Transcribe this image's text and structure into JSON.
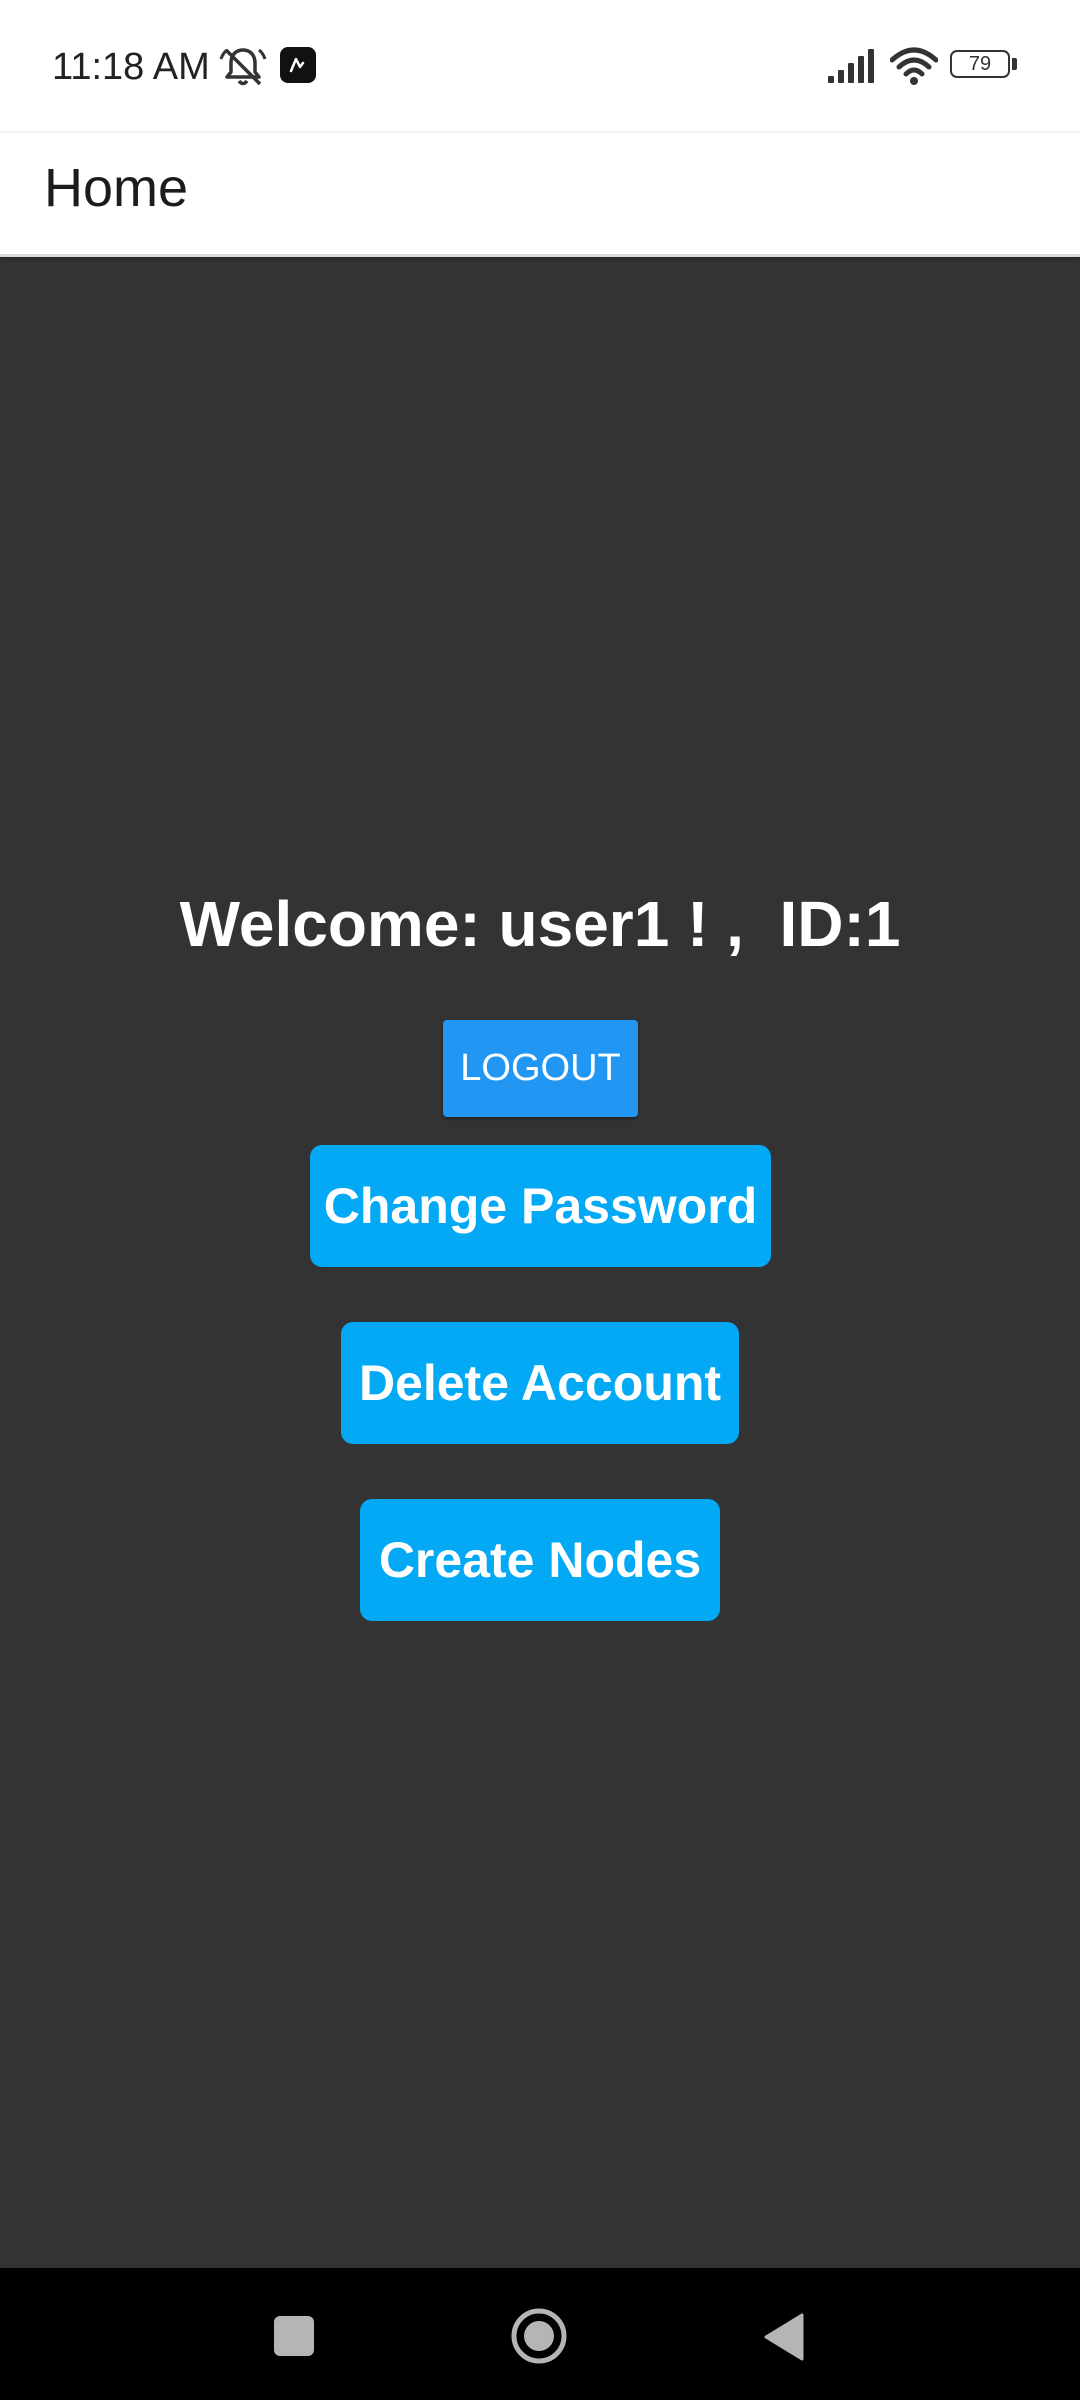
{
  "status_bar": {
    "time": "11:18 AM",
    "battery": "79",
    "icons": [
      "bell-muted-icon",
      "app-notification-icon",
      "signal-icon",
      "wifi-icon",
      "battery-icon"
    ]
  },
  "app_bar": {
    "title": "Home"
  },
  "main": {
    "welcome_text": "Welcome: user1 ! ,  ID:1",
    "logout_label": "LOGOUT",
    "change_password_label": "Change Password",
    "delete_account_label": "Delete Account",
    "create_nodes_label": "Create Nodes"
  },
  "nav_bar": {
    "icons": [
      "recents-icon",
      "home-icon",
      "back-icon"
    ]
  },
  "colors": {
    "background": "#333333",
    "logout_button": "#2196f3",
    "action_button": "#03a9f4",
    "app_bar": "#ffffff",
    "nav_bar": "#000000"
  }
}
